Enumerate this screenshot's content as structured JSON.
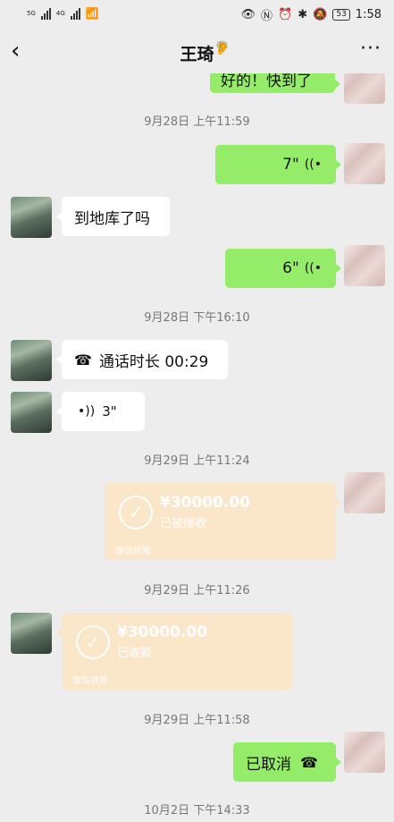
{
  "status_bar": {
    "net_top": "5G",
    "net_top2": "4G",
    "time": "1:58",
    "battery": "53"
  },
  "header": {
    "title": "王琦",
    "back_icon": "back-arrow-icon",
    "ear_icon": "ear-icon",
    "more_icon": "more-icon"
  },
  "messages": {
    "m0_text": "好的！快到了",
    "t1": "9月28日 上午11:59",
    "m1_duration": "7\"",
    "m2_text": "到地库了吗",
    "m3_duration": "6\"",
    "t2": "9月28日 下午16:10",
    "m4_call": "通话时长 00:29",
    "m5_duration": "3\"",
    "t3": "9月29日 上午11:24",
    "m6_amount": "¥30000.00",
    "m6_status": "已被接收",
    "m6_brand": "微信转账",
    "t4": "9月29日 上午11:26",
    "m7_amount": "¥30000.00",
    "m7_status": "已收款",
    "m7_brand": "微信转账",
    "t5": "9月29日 上午11:58",
    "m8_text": "已取消",
    "t6": "10月2日 下午14:33"
  },
  "colors": {
    "self_bubble": "#95ec69",
    "other_bubble": "#ffffff",
    "transfer": "#fae6c8",
    "background": "#ededed"
  }
}
